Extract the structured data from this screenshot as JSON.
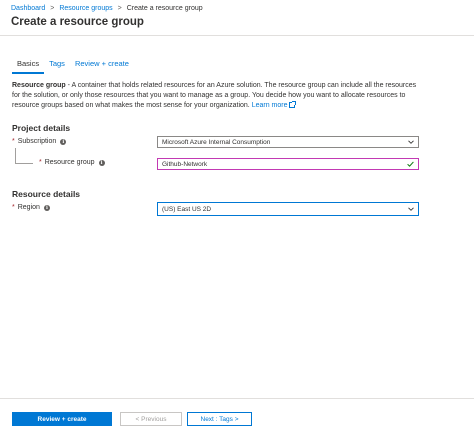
{
  "breadcrumb": {
    "items": [
      "Dashboard",
      "Resource groups",
      "Create a resource group"
    ],
    "separator": ">"
  },
  "page": {
    "title": "Create a resource group"
  },
  "tabs": [
    {
      "label": "Basics",
      "active": true
    },
    {
      "label": "Tags",
      "active": false
    },
    {
      "label": "Review + create",
      "active": false
    }
  ],
  "description": {
    "lead": "Resource group",
    "body": " - A container that holds related resources for an Azure solution. The resource group can include all the resources for the solution, or only those resources that you want to manage as a group. You decide how you want to allocate resources to resource groups based on what makes the most sense for your organization. ",
    "learn_more": "Learn more",
    "learn_more_icon": "external-link-icon"
  },
  "project_details": {
    "title": "Project details",
    "subscription": {
      "label": "Subscription",
      "value": "Microsoft Azure Internal Consumption",
      "required_mark": "*"
    },
    "resource_group": {
      "label": "Resource group",
      "value": "Github-Network",
      "required_mark": "*",
      "valid_icon": "checkmark-icon"
    }
  },
  "resource_details": {
    "title": "Resource details",
    "region": {
      "label": "Region",
      "value": "(US) East US 2D",
      "required_mark": "*"
    }
  },
  "info_glyph": "i",
  "footer": {
    "review_create": "Review + create",
    "previous": "< Previous",
    "next": "Next : Tags >"
  },
  "colors": {
    "accent": "#0078d4",
    "required": "#a4262c",
    "valid_input_border": "#c239b3",
    "valid_check": "#107c10"
  }
}
